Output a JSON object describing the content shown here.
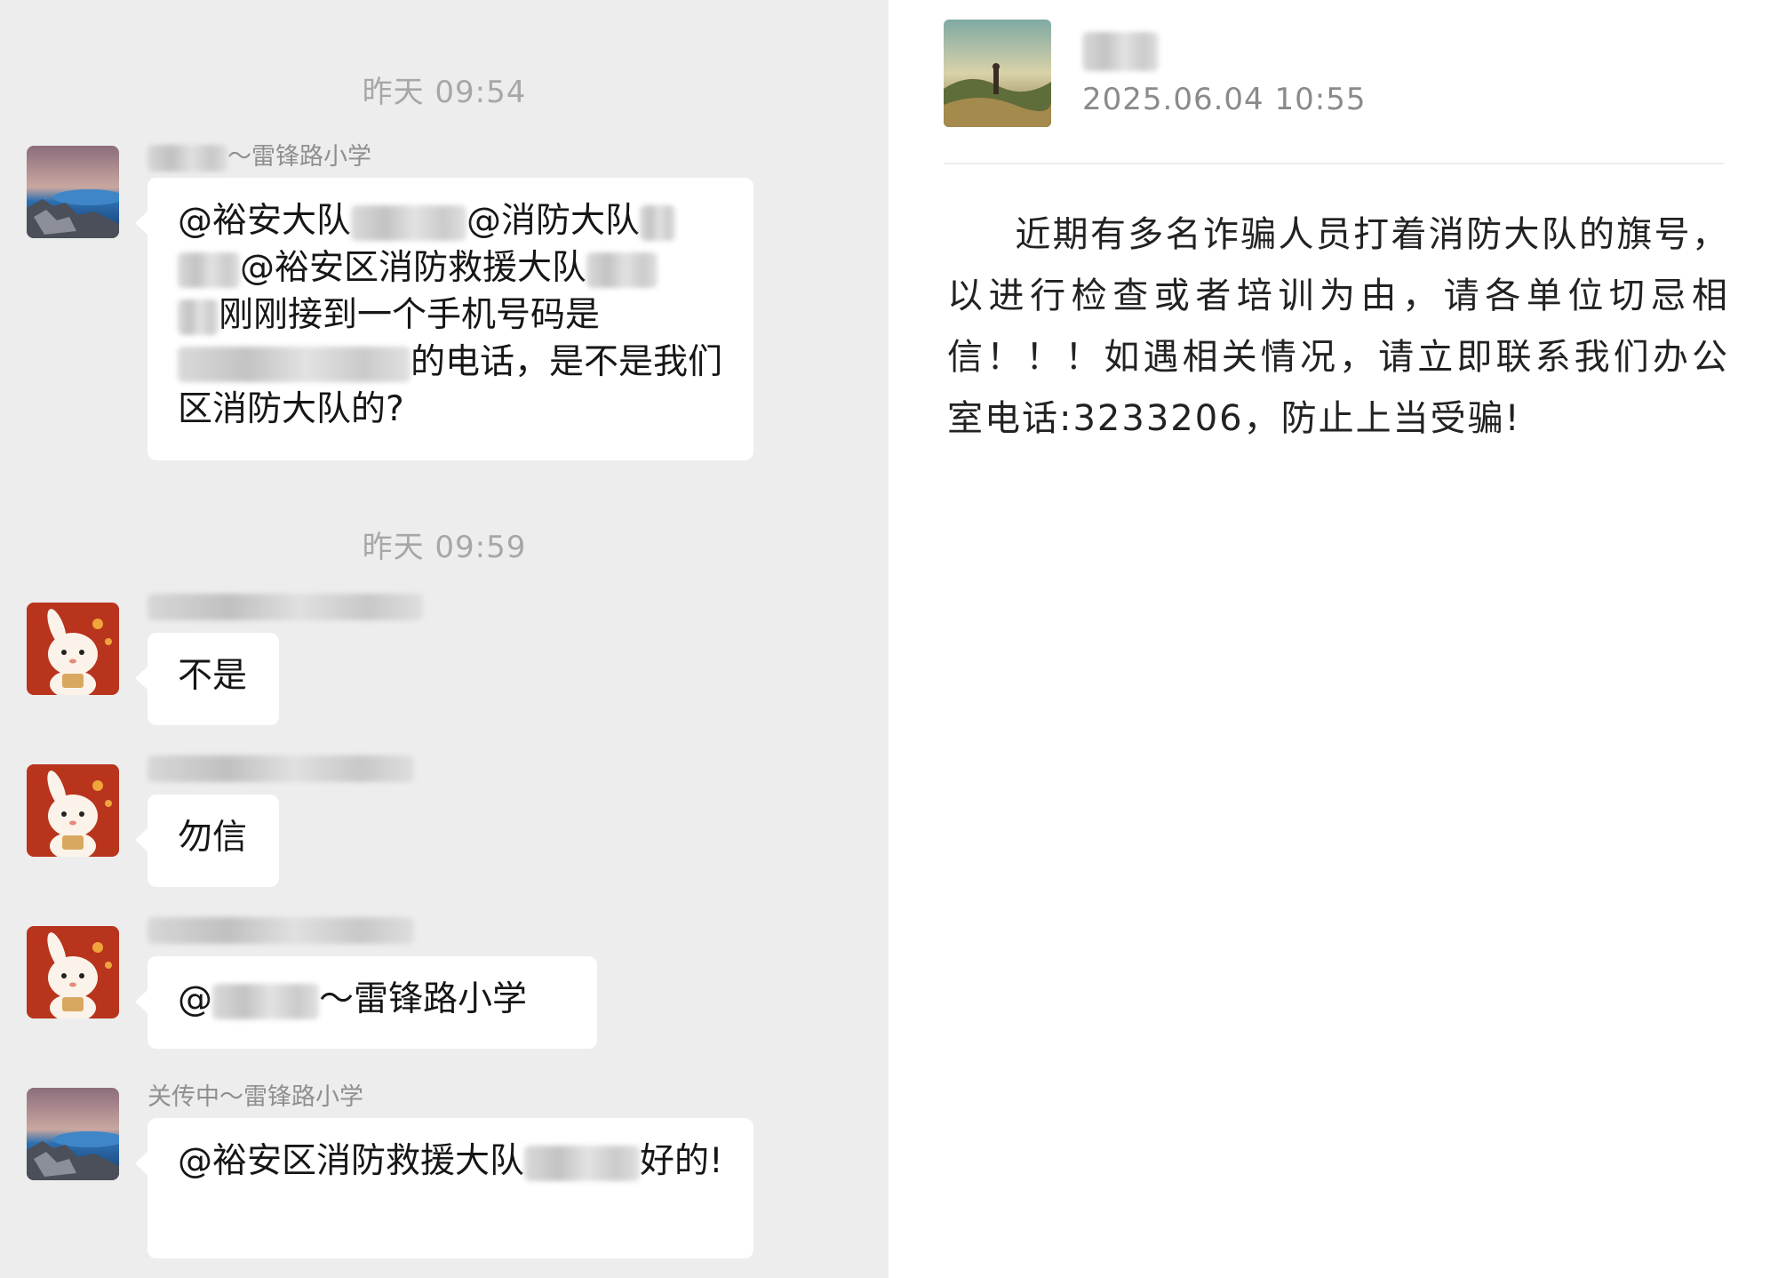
{
  "chat": {
    "timestamps": [
      "昨天 09:54",
      "昨天 09:59"
    ],
    "messages": [
      {
        "sender": "～雷锋路小学",
        "text_parts": [
          "@裕安大队",
          "@消防大队",
          "@裕安区消防救援大队",
          "刚刚接到一个手机号码是",
          "的电话，是不是我们区消防大队的?"
        ]
      },
      {
        "sender": "",
        "text": "不是"
      },
      {
        "sender": "",
        "text": "勿信"
      },
      {
        "sender": "",
        "text_parts": [
          "@",
          "～雷锋路小学"
        ]
      },
      {
        "sender": "关传中～雷锋路小学",
        "text_parts": [
          "@裕安区消防救援大队",
          "好的!"
        ]
      }
    ]
  },
  "post": {
    "date": "2025.06.04  10:55",
    "body": "近期有多名诈骗人员打着消防大队的旗号，以进行检查或者培训为由，请各单位切忌相信！！！如遇相关情况，请立即联系我们办公室电话:3233206，防止上当受骗!"
  },
  "colors": {
    "chat_background": "#ededed",
    "bubble_background": "#ffffff",
    "timestamp_text": "#a7a7a7",
    "sender_text": "#8f8f8f"
  },
  "icons": [
    "landscape-avatar-icon",
    "cartoon-rabbit-avatar-icon"
  ]
}
